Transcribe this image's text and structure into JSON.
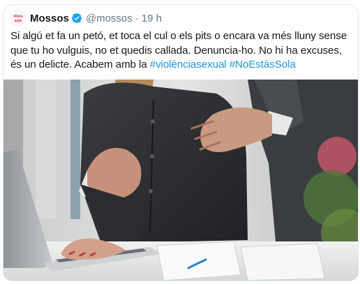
{
  "tweet": {
    "display_name": "Mossos",
    "avatar_text": "mos\nsos",
    "handle": "@mossos",
    "separator": "·",
    "timestamp": "19 h",
    "text_main": "Si algú et fa un petó, et toca el cul o els pits o encara va més lluny sense que tu ho vulguis, no et quedis callada. Denuncia-ho. No hi ha excuses, és un delicte. Acabem amb la ",
    "hashtag_1": "#violènciasexual",
    "text_space": " ",
    "hashtag_2": "#NoEstàsSola",
    "colors": {
      "hashtag": "#1b95e0",
      "verified": "#1da1f2",
      "avatar_brand": "#d81e34"
    },
    "icons": [
      "avatar-logo",
      "verified-badge-icon"
    ]
  }
}
